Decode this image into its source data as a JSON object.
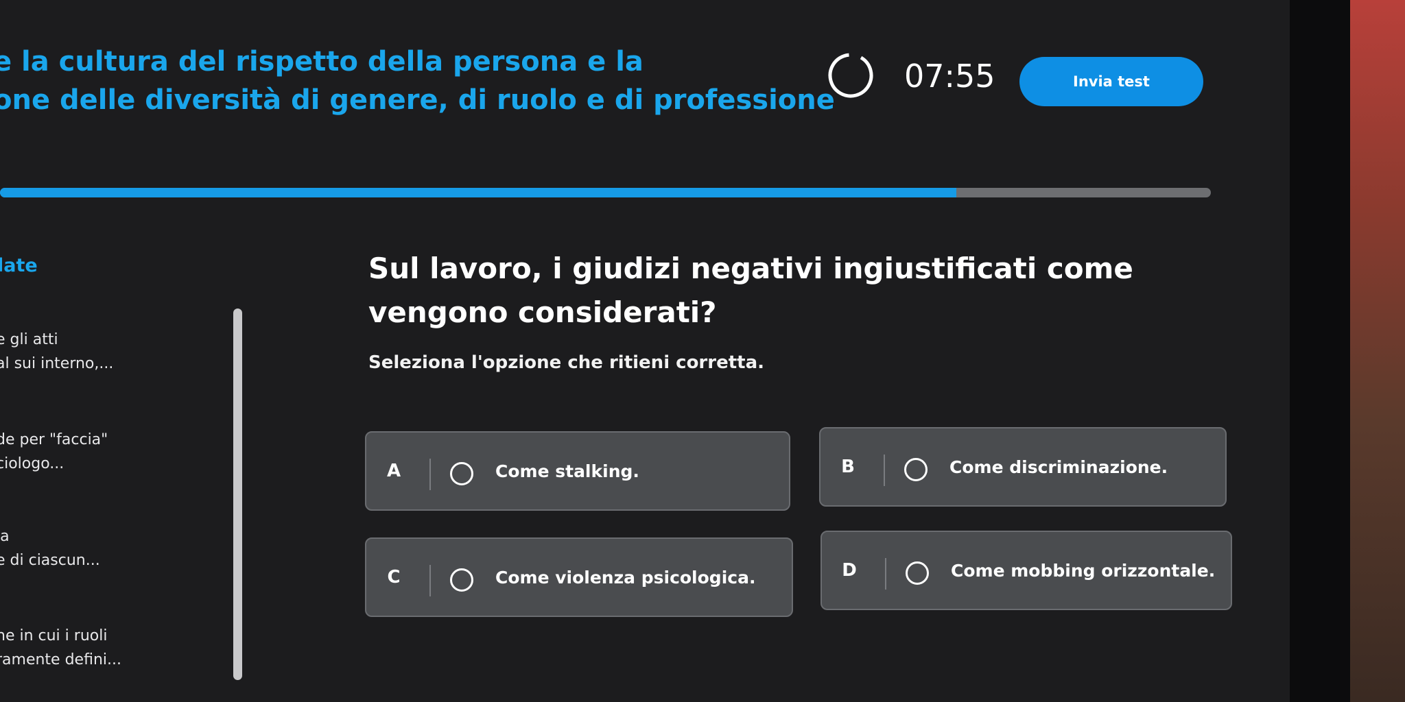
{
  "header": {
    "course_title_line1": "e la cultura del rispetto della persona e la",
    "course_title_line2": "one delle diversità di genere, di ruolo e di professione",
    "timer": "07:55",
    "submit_label": "Invia test"
  },
  "progress": {
    "fraction": 0.79,
    "fill_color": "#169be6",
    "track_color": "#6d6e71"
  },
  "sidebar": {
    "heading": "late",
    "items": [
      {
        "line1": "e gli atti",
        "line2": "al sui interno,..."
      },
      {
        "line1": "de per \"faccia\"",
        "line2": "ciologo..."
      },
      {
        "line1": "la",
        "line2": "e di ciascun..."
      },
      {
        "line1": "ne in cui i ruoli",
        "line2": "ramente defini..."
      }
    ]
  },
  "question": {
    "title": "Sul lavoro, i giudizi negativi ingiustificati come vengono considerati?",
    "instruction": "Seleziona l'opzione che ritieni corretta."
  },
  "options": [
    {
      "letter": "A",
      "label": "Come stalking."
    },
    {
      "letter": "B",
      "label": "Come discriminazione."
    },
    {
      "letter": "C",
      "label": "Come violenza psicologica."
    },
    {
      "letter": "D",
      "label": "Come mobbing orizzontale."
    }
  ],
  "colors": {
    "accent": "#1aa6ec",
    "background": "#1c1c1e",
    "option_bg": "#4a4c4f"
  }
}
